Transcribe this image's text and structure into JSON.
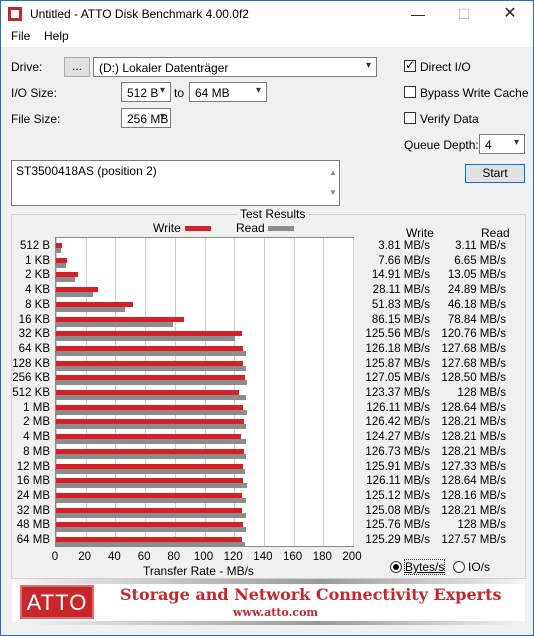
{
  "window": {
    "title": "Untitled - ATTO Disk Benchmark 4.00.0f2"
  },
  "titlebar": {
    "minimize": "—",
    "maximize": "☐",
    "close": "✕"
  },
  "menu": {
    "file": "File",
    "help": "Help"
  },
  "drive": {
    "label": "Drive:",
    "browse": "...",
    "value": "(D:) Lokaler Datenträger"
  },
  "io_size": {
    "label": "I/O Size:",
    "from": "512 B",
    "to_label": "to",
    "to": "64 MB"
  },
  "file_size": {
    "label": "File Size:",
    "value": "256 MB"
  },
  "options": {
    "direct_io": {
      "label": "Direct I/O",
      "checked": true
    },
    "bypass_write_cache": {
      "label": "Bypass Write Cache",
      "checked": false
    },
    "verify_data": {
      "label": "Verify Data",
      "checked": false
    },
    "queue_depth": {
      "label": "Queue Depth:",
      "value": "4"
    }
  },
  "start_button": "Start",
  "description": "ST3500418AS (position 2)",
  "results": {
    "group_title": "Test Results",
    "legend_write": "Write",
    "legend_read": "Read",
    "col_write": "Write",
    "col_read": "Read",
    "write_color": "#d42026",
    "read_color": "#8c8c8c",
    "write_texts": [
      "3.81 MB/s",
      "7.66 MB/s",
      "14.91 MB/s",
      "28.11 MB/s",
      "51.83 MB/s",
      "86.15 MB/s",
      "125.56 MB/s",
      "126.18 MB/s",
      "125.87 MB/s",
      "127.05 MB/s",
      "123.37 MB/s",
      "126.11 MB/s",
      "126.42 MB/s",
      "124.27 MB/s",
      "126.73 MB/s",
      "125.91 MB/s",
      "126.11 MB/s",
      "125.12 MB/s",
      "125.08 MB/s",
      "125.76 MB/s",
      "125.29 MB/s"
    ],
    "read_texts": [
      "3.11 MB/s",
      "6.65 MB/s",
      "13.05 MB/s",
      "24.89 MB/s",
      "46.18 MB/s",
      "78.84 MB/s",
      "120.76 MB/s",
      "127.68 MB/s",
      "127.68 MB/s",
      "128.50 MB/s",
      "128 MB/s",
      "128.64 MB/s",
      "128.21 MB/s",
      "128.21 MB/s",
      "128.21 MB/s",
      "127.33 MB/s",
      "128.64 MB/s",
      "128.16 MB/s",
      "128.21 MB/s",
      "128 MB/s",
      "127.57 MB/s"
    ],
    "units": {
      "bytes": "Bytes/s",
      "io": "IO/s",
      "selected": "bytes"
    }
  },
  "chart_data": {
    "type": "bar",
    "orientation": "horizontal",
    "xlabel": "Transfer Rate - MB/s",
    "xlim": [
      0,
      200
    ],
    "xticks": [
      "0",
      "20",
      "40",
      "60",
      "80",
      "100",
      "120",
      "140",
      "160",
      "180",
      "200"
    ],
    "categories": [
      "512 B",
      "1 KB",
      "2 KB",
      "4 KB",
      "8 KB",
      "16 KB",
      "32 KB",
      "64 KB",
      "128 KB",
      "256 KB",
      "512 KB",
      "1 MB",
      "2 MB",
      "4 MB",
      "8 MB",
      "12 MB",
      "16 MB",
      "24 MB",
      "32 MB",
      "48 MB",
      "64 MB"
    ],
    "series": [
      {
        "name": "Write",
        "values": [
          3.81,
          7.66,
          14.91,
          28.11,
          51.83,
          86.15,
          125.56,
          126.18,
          125.87,
          127.05,
          123.37,
          126.11,
          126.42,
          124.27,
          126.73,
          125.91,
          126.11,
          125.12,
          125.08,
          125.76,
          125.29
        ]
      },
      {
        "name": "Read",
        "values": [
          3.11,
          6.65,
          13.05,
          24.89,
          46.18,
          78.84,
          120.76,
          127.68,
          127.68,
          128.5,
          128,
          128.64,
          128.21,
          128.21,
          128.21,
          127.33,
          128.64,
          128.16,
          128.21,
          128,
          127.57
        ]
      }
    ],
    "grid": true,
    "legend": "top"
  },
  "banner": {
    "logo": "ATTO",
    "tagline": "Storage and Network Connectivity Experts",
    "url": "www.atto.com"
  }
}
